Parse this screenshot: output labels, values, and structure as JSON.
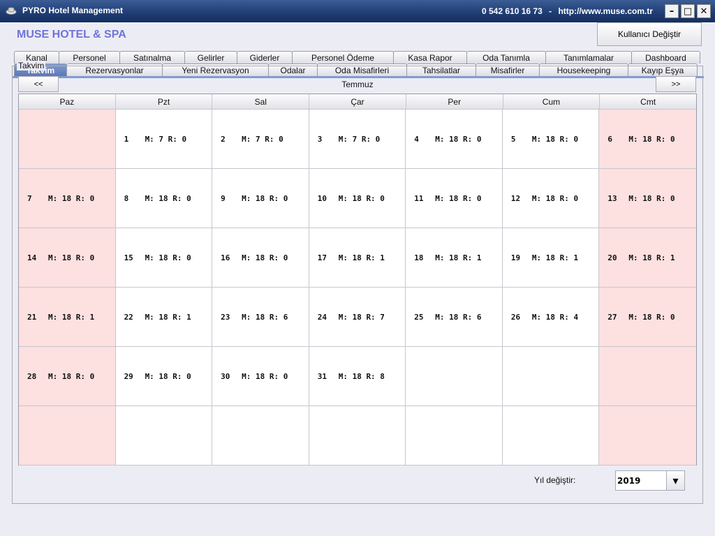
{
  "window": {
    "title": "PYRO Hotel Management",
    "phone": "0 542 610 16 73",
    "separator": "-",
    "url": "http://www.muse.com.tr",
    "min_glyph": "–",
    "max_glyph": "□",
    "close_glyph": "✕"
  },
  "header": {
    "hotel_name": "MUSE HOTEL & SPA",
    "user_button": "Kullanıcı Değiştir"
  },
  "tabs_top": [
    {
      "label": "Kanal",
      "width": 65
    },
    {
      "label": "Personel",
      "width": 88
    },
    {
      "label": "Satınalma",
      "width": 94
    },
    {
      "label": "Gelirler",
      "width": 76
    },
    {
      "label": "Giderler",
      "width": 80
    },
    {
      "label": "Personel Ödeme",
      "width": 146
    },
    {
      "label": "Kasa Rapor",
      "width": 106
    },
    {
      "label": "Oda Tanımla",
      "width": 114
    },
    {
      "label": "Tanımlamalar",
      "width": 124
    },
    {
      "label": "Dashboard",
      "width": 99
    }
  ],
  "tabs_bottom": [
    {
      "label": "Takvim",
      "width": 76,
      "active": true
    },
    {
      "label": "Rezervasyonlar",
      "width": 138
    },
    {
      "label": "Yeni Rezervasyon",
      "width": 153
    },
    {
      "label": "Odalar",
      "width": 71
    },
    {
      "label": "Oda Misafirleri",
      "width": 129
    },
    {
      "label": "Tahsilatlar",
      "width": 100
    },
    {
      "label": "Misafirler",
      "width": 92
    },
    {
      "label": "Housekeeping",
      "width": 128
    },
    {
      "label": "Kayıp Eşya",
      "width": 100
    }
  ],
  "panel": {
    "title": "Takvim",
    "prev_label": "<<",
    "next_label": ">>",
    "month": "Temmuz"
  },
  "calendar": {
    "weekdays": [
      "Paz",
      "Pzt",
      "Sal",
      "Çar",
      "Per",
      "Cum",
      "Cmt"
    ],
    "weekend_bg": "#fde0e0",
    "cells": [
      null,
      {
        "day": "1",
        "mr": "M: 7 R: 0"
      },
      {
        "day": "2",
        "mr": "M: 7 R: 0"
      },
      {
        "day": "3",
        "mr": "M: 7 R: 0"
      },
      {
        "day": "4",
        "mr": "M: 18 R: 0"
      },
      {
        "day": "5",
        "mr": "M: 18 R: 0"
      },
      {
        "day": "6",
        "mr": "M: 18 R: 0"
      },
      {
        "day": "7",
        "mr": "M: 18 R: 0"
      },
      {
        "day": "8",
        "mr": "M: 18 R: 0"
      },
      {
        "day": "9",
        "mr": "M: 18 R: 0"
      },
      {
        "day": "10",
        "mr": "M: 18 R: 0"
      },
      {
        "day": "11",
        "mr": "M: 18 R: 0"
      },
      {
        "day": "12",
        "mr": "M: 18 R: 0"
      },
      {
        "day": "13",
        "mr": "M: 18 R: 0"
      },
      {
        "day": "14",
        "mr": "M: 18 R: 0"
      },
      {
        "day": "15",
        "mr": "M: 18 R: 0"
      },
      {
        "day": "16",
        "mr": "M: 18 R: 0"
      },
      {
        "day": "17",
        "mr": "M: 18 R: 1"
      },
      {
        "day": "18",
        "mr": "M: 18 R: 1"
      },
      {
        "day": "19",
        "mr": "M: 18 R: 1"
      },
      {
        "day": "20",
        "mr": "M: 18 R: 1"
      },
      {
        "day": "21",
        "mr": "M: 18 R: 1"
      },
      {
        "day": "22",
        "mr": "M: 18 R: 1"
      },
      {
        "day": "23",
        "mr": "M: 18 R: 6"
      },
      {
        "day": "24",
        "mr": "M: 18 R: 7"
      },
      {
        "day": "25",
        "mr": "M: 18 R: 6"
      },
      {
        "day": "26",
        "mr": "M: 18 R: 4"
      },
      {
        "day": "27",
        "mr": "M: 18 R: 0"
      },
      {
        "day": "28",
        "mr": "M: 18 R: 0"
      },
      {
        "day": "29",
        "mr": "M: 18 R: 0"
      },
      {
        "day": "30",
        "mr": "M: 18 R: 0"
      },
      {
        "day": "31",
        "mr": "M: 18 R: 8"
      },
      null,
      null,
      null,
      null,
      null,
      null,
      null,
      null,
      null,
      null
    ]
  },
  "footer": {
    "year_label": "Yıl değiştir:",
    "year_value": "2019",
    "dropdown_glyph": "▾"
  }
}
